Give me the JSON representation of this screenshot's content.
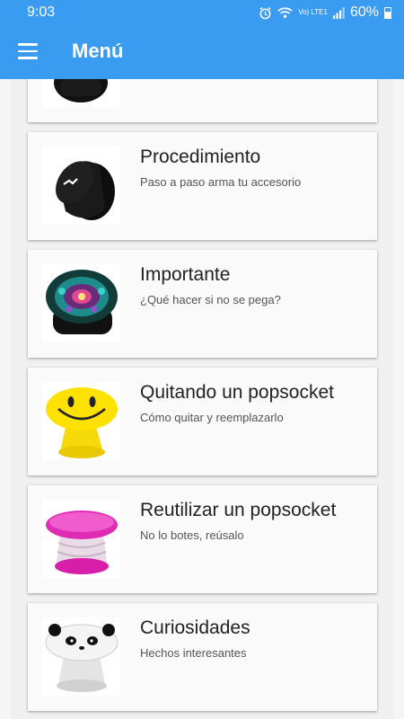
{
  "status": {
    "time": "9:03",
    "battery": "60%",
    "network": "Vo) LTE1"
  },
  "appbar": {
    "title": "Menú"
  },
  "items": [
    {
      "title": "",
      "subtitle": "",
      "icon": "black-popsocket-icon"
    },
    {
      "title": "Procedimiento",
      "subtitle": "Paso a paso arma tu accesorio",
      "icon": "black-popsocket-icon"
    },
    {
      "title": "Importante",
      "subtitle": "¿Qué hacer si no se pega?",
      "icon": "mandala-popsocket-icon"
    },
    {
      "title": "Quitando un popsocket",
      "subtitle": "Cómo quitar y reemplazarlo",
      "icon": "smiley-popsocket-icon"
    },
    {
      "title": "Reutilizar un popsocket",
      "subtitle": "No lo botes, reúsalo",
      "icon": "pink-popsocket-icon"
    },
    {
      "title": "Curiosidades",
      "subtitle": "Hechos interesantes",
      "icon": "panda-popsocket-icon"
    }
  ],
  "colors": {
    "appbar": "#3a9cf0",
    "card": "#fafafa"
  }
}
